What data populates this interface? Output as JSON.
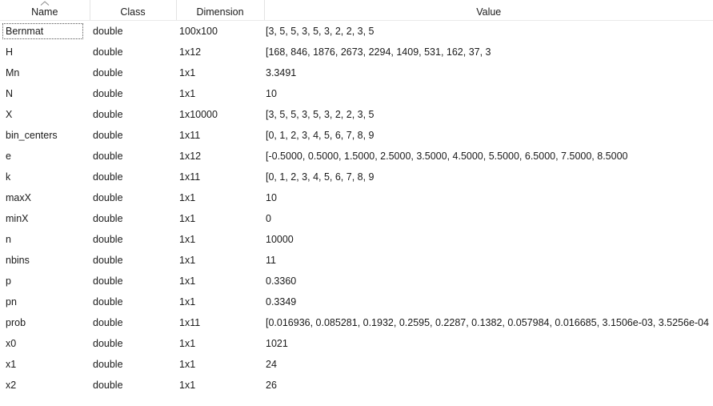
{
  "columns": [
    {
      "label": "Name",
      "sorted": true
    },
    {
      "label": "Class"
    },
    {
      "label": "Dimension"
    },
    {
      "label": "Value"
    }
  ],
  "selected_row": 0,
  "rows": [
    {
      "name": "Bernmat",
      "class": "double",
      "dim": "100x100",
      "value": "[3, 5, 5, 3, 5, 3, 2, 2, 3, 5"
    },
    {
      "name": "H",
      "class": "double",
      "dim": "1x12",
      "value": "[168, 846, 1876, 2673, 2294, 1409, 531, 162, 37, 3"
    },
    {
      "name": "Mn",
      "class": "double",
      "dim": "1x1",
      "value": "3.3491"
    },
    {
      "name": "N",
      "class": "double",
      "dim": "1x1",
      "value": "10"
    },
    {
      "name": "X",
      "class": "double",
      "dim": "1x10000",
      "value": "[3, 5, 5, 3, 5, 3, 2, 2, 3, 5"
    },
    {
      "name": "bin_centers",
      "class": "double",
      "dim": "1x11",
      "value": "[0, 1, 2, 3, 4, 5, 6, 7, 8, 9"
    },
    {
      "name": "e",
      "class": "double",
      "dim": "1x12",
      "value": "[-0.5000, 0.5000, 1.5000, 2.5000, 3.5000, 4.5000, 5.5000, 6.5000, 7.5000, 8.5000"
    },
    {
      "name": "k",
      "class": "double",
      "dim": "1x11",
      "value": "[0, 1, 2, 3, 4, 5, 6, 7, 8, 9"
    },
    {
      "name": "maxX",
      "class": "double",
      "dim": "1x1",
      "value": "10"
    },
    {
      "name": "minX",
      "class": "double",
      "dim": "1x1",
      "value": "0"
    },
    {
      "name": "n",
      "class": "double",
      "dim": "1x1",
      "value": "10000"
    },
    {
      "name": "nbins",
      "class": "double",
      "dim": "1x1",
      "value": "11"
    },
    {
      "name": "p",
      "class": "double",
      "dim": "1x1",
      "value": "0.3360"
    },
    {
      "name": "pn",
      "class": "double",
      "dim": "1x1",
      "value": "0.3349"
    },
    {
      "name": "prob",
      "class": "double",
      "dim": "1x11",
      "value": "[0.016936, 0.085281, 0.1932, 0.2595, 0.2287, 0.1382, 0.057984, 0.016685, 3.1506e-03, 3.5256e-04"
    },
    {
      "name": "x0",
      "class": "double",
      "dim": "1x1",
      "value": "1021"
    },
    {
      "name": "x1",
      "class": "double",
      "dim": "1x1",
      "value": "24"
    },
    {
      "name": "x2",
      "class": "double",
      "dim": "1x1",
      "value": "26"
    }
  ]
}
